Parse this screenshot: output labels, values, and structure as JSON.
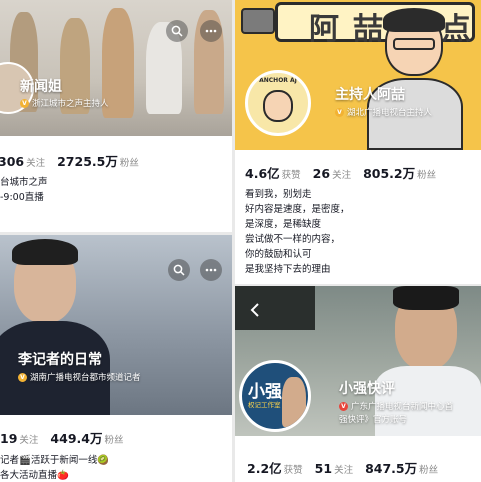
{
  "cards": {
    "c1": {
      "name": "新闻姐",
      "cert": "浙江城市之声主持人",
      "stats": [
        {
          "value": "306",
          "label": "关注"
        },
        {
          "value": "2725.5万",
          "label": "粉丝"
        }
      ],
      "bio": [
        "台城市之声",
        "-9:00直播"
      ]
    },
    "c2": {
      "banner_title": "阿喆视点",
      "avatar_ring_text": "ANCHOR AJ",
      "name": "主持人阿喆",
      "cert": "湖北广播电视台主持人",
      "stats": [
        {
          "value": "4.6亿",
          "label": "获赞"
        },
        {
          "value": "26",
          "label": "关注"
        },
        {
          "value": "805.2万",
          "label": "粉丝"
        }
      ],
      "bio": [
        "看到我，别划走",
        "好内容是速度，是密度，",
        "是深度，是稀缺度",
        "尝试做不一样的内容，",
        "你的鼓励和认可",
        "是我坚持下去的理由"
      ]
    },
    "c3": {
      "name": "李记者的日常",
      "cert": "湖南广播电视台都市频道记者",
      "stats": [
        {
          "value": "19",
          "label": "关注"
        },
        {
          "value": "449.4万",
          "label": "粉丝"
        }
      ],
      "bio": [
        "记者🎬活跃于新闻一线🥝",
        "各大活动直播🍅"
      ]
    },
    "c4": {
      "name": "小强快评",
      "avatar_text": "小强",
      "avatar_subtext": "权记工作室",
      "cert_line1": "广东广播电视台新闻中心首",
      "cert_line2": "强快评》官方账号",
      "stats": [
        {
          "value": "2.2亿",
          "label": "获赞"
        },
        {
          "value": "51",
          "label": "关注"
        },
        {
          "value": "847.5万",
          "label": "粉丝"
        }
      ]
    }
  }
}
